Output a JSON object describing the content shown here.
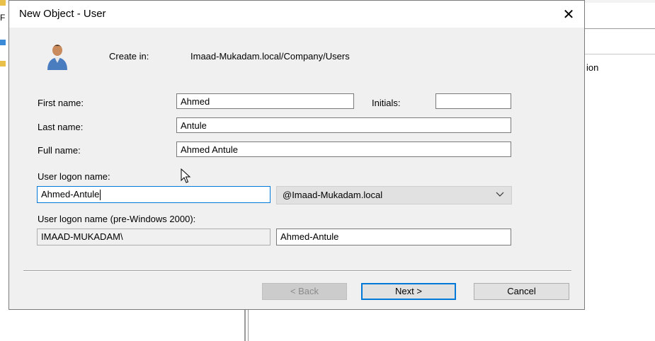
{
  "background": {
    "left_text": "F",
    "right_text": "ion"
  },
  "dialog": {
    "title": "New Object - User",
    "close_glyph": "✕",
    "create_in_label": "Create in:",
    "create_in_path": "Imaad-Mukadam.local/Company/Users"
  },
  "form": {
    "first_name_label": "First name:",
    "first_name_value": "Ahmed",
    "initials_label": "Initials:",
    "initials_value": "",
    "last_name_label": "Last name:",
    "last_name_value": "Antule",
    "full_name_label": "Full name:",
    "full_name_value": "Ahmed Antule",
    "logon_label": "User logon name:",
    "logon_value": "Ahmed-Antule",
    "domain_selected": "@Imaad-Mukadam.local",
    "pre2000_label": "User logon name (pre-Windows 2000):",
    "pre2000_domain": "IMAAD-MUKADAM\\",
    "pre2000_value": "Ahmed-Antule"
  },
  "buttons": {
    "back": "< Back",
    "next": "Next >",
    "cancel": "Cancel"
  },
  "icons": {
    "user": "user-icon",
    "close": "close-icon",
    "dropdown": "chevron-down-icon",
    "cursor": "mouse-pointer-icon"
  }
}
